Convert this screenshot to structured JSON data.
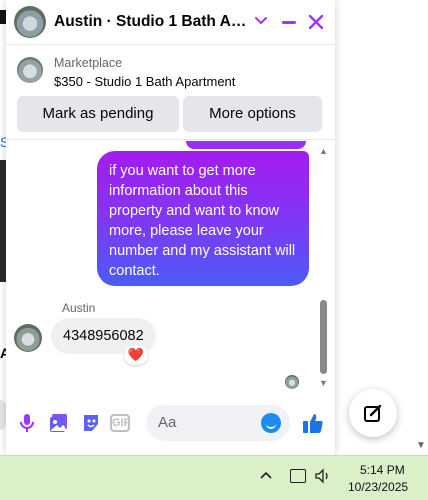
{
  "background": {
    "left_glyph_blue": "S",
    "left_glyph_letter": "A"
  },
  "chat_header": {
    "title": "Austin · Studio 1 Bath Apar...",
    "chevron_icon": "chevron-down-icon",
    "minimize_icon": "minimize-icon",
    "close_icon": "close-icon",
    "accent_color": "#a033ff"
  },
  "listing": {
    "label": "Marketplace",
    "price_title": "$350 - Studio 1 Bath Apartment",
    "mark_pending_label": "Mark as pending",
    "more_options_label": "More options"
  },
  "messages": {
    "outgoing": [
      {
        "text": "if you want to get more information about this property and want to know more, please leave your number and my assistant will contact."
      }
    ],
    "incoming": [
      {
        "sender": "Austin",
        "text": "4348956082",
        "reaction": "❤️"
      }
    ]
  },
  "composer": {
    "placeholder": "Aa",
    "gif_label": "GIF",
    "icons": [
      "mic-icon",
      "photo-icon",
      "sticker-icon",
      "gif-icon",
      "emoji-icon",
      "like-icon"
    ]
  },
  "taskbar": {
    "time": "5:14 PM",
    "date": "10/23/2025",
    "color": "#d9f0c9"
  }
}
